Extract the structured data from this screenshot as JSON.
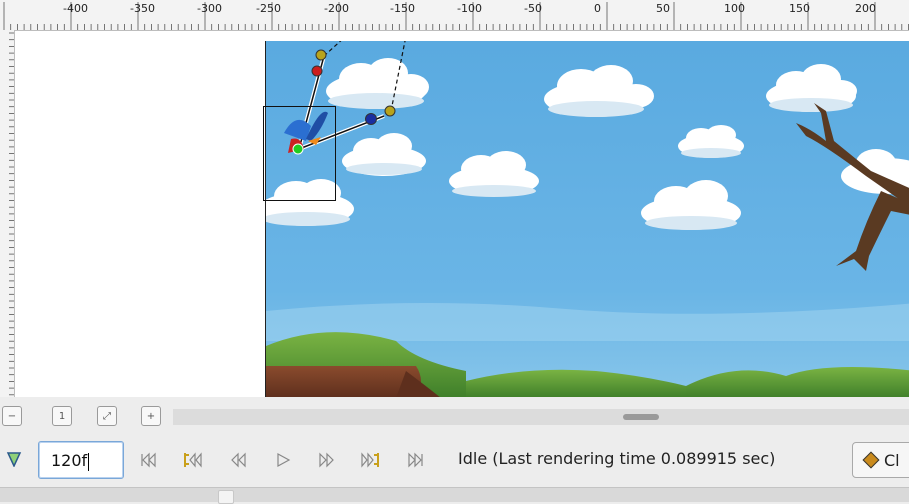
{
  "ruler": {
    "labels": [
      "-400",
      "-350",
      "-300",
      "-250",
      "-200",
      "-150",
      "-100",
      "-50",
      "0",
      "50",
      "100",
      "150",
      "200"
    ]
  },
  "scroll_buttons": [
    {
      "name": "zoom-out-icon",
      "glyph": "−"
    },
    {
      "name": "zoom-100-icon",
      "glyph": "1"
    },
    {
      "name": "zoom-fit-icon",
      "glyph": "⤢"
    },
    {
      "name": "zoom-in-icon",
      "glyph": "+"
    }
  ],
  "transport": {
    "frame_value": "120f",
    "status": "Idle (Last rendering time 0.089915 sec)",
    "keyframe_button_label": "Cl"
  },
  "colors": {
    "sky": "#5fb0e2",
    "accent": "#c9a01c",
    "frame_border": "#7aa7d8"
  }
}
